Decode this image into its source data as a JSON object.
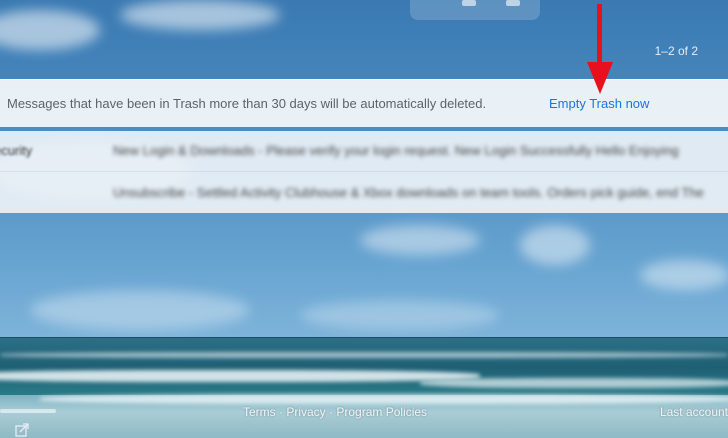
{
  "header": {
    "pagination": "1–2 of 2"
  },
  "notice": {
    "text": "Messages that have been in Trash more than 30 days will be automatically deleted.",
    "action_label": "Empty Trash now",
    "action_color": "#1a73e8"
  },
  "messages": [
    {
      "sender": "ecurity",
      "snippet": "New Login & Downloads - Please verify your login request. New Login Successfully Hello Enjoying"
    },
    {
      "sender": "",
      "snippet": "Unsubscribe - Settled Activity Clubhouse & Xbox downloads on team tools. Orders pick guide, end The"
    }
  ],
  "footer": {
    "links": [
      "Terms",
      "Privacy",
      "Program Policies"
    ],
    "separator": " · ",
    "right_text": "Last account"
  },
  "annotation": {
    "arrow_color": "#e8101c"
  },
  "icons": {
    "open_in_new": "external-link-icon"
  }
}
